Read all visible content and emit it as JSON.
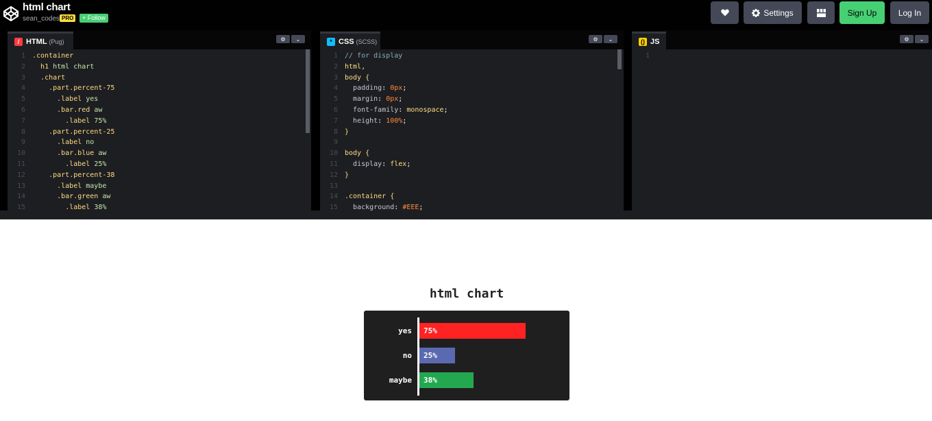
{
  "header": {
    "title": "html chart",
    "author": "sean_codes",
    "pro_badge": "PRO",
    "follow_label": "+ Follow",
    "buttons": {
      "love_icon": "heart-icon",
      "settings_label": "Settings",
      "layout_icon": "layout-icon",
      "signup_label": "Sign Up",
      "login_label": "Log In"
    }
  },
  "editors": {
    "html": {
      "tab_label": "HTML",
      "tab_sub": "(Pug)",
      "lines": [
        ".container",
        "  h1 html chart",
        "  .chart",
        "    .part.percent-75",
        "      .label yes",
        "      .bar.red aw",
        "        .label 75%",
        "    .part.percent-25",
        "      .label no",
        "      .bar.blue aw",
        "        .label 25%",
        "    .part.percent-38",
        "      .label maybe",
        "      .bar.green aw",
        "        .label 38%"
      ]
    },
    "css": {
      "tab_label": "CSS",
      "tab_sub": "(SCSS)",
      "lines": [
        "// for display",
        "html,",
        "body {",
        "  padding: 0px;",
        "  margin: 0px;",
        "  font-family: monospace;",
        "  height: 100%;",
        "}",
        "",
        "body {",
        "  display: flex;",
        "}",
        "",
        ".container {",
        "  background: #EEE;"
      ]
    },
    "js": {
      "tab_label": "JS",
      "lines": [
        ""
      ]
    }
  },
  "chart_data": {
    "type": "bar",
    "orientation": "horizontal",
    "title": "html chart",
    "categories": [
      "yes",
      "no",
      "maybe"
    ],
    "values": [
      75,
      25,
      38
    ],
    "value_labels": [
      "75%",
      "25%",
      "38%"
    ],
    "colors": [
      "#ff2222",
      "#5a69b0",
      "#23a850"
    ],
    "xlim": [
      0,
      100
    ]
  }
}
